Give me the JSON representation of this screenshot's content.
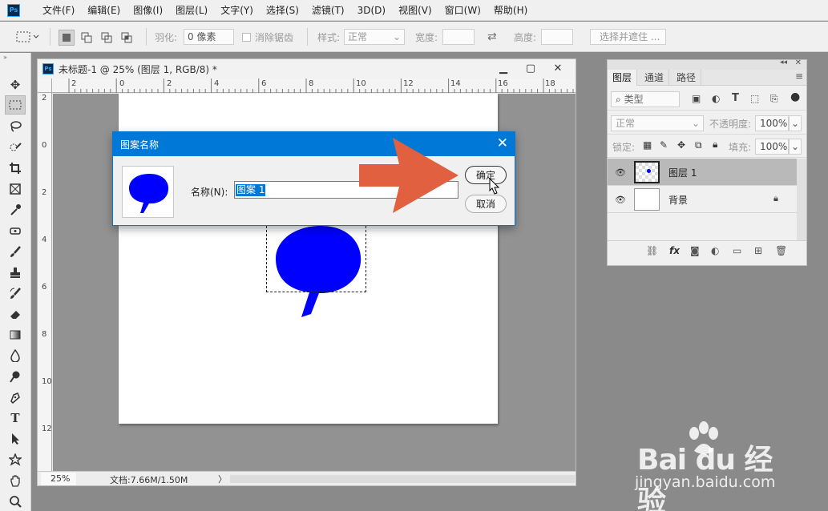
{
  "app": {
    "logo": "Ps",
    "menu": [
      "文件(F)",
      "编辑(E)",
      "图像(I)",
      "图层(L)",
      "文字(Y)",
      "选择(S)",
      "滤镜(T)",
      "3D(D)",
      "视图(V)",
      "窗口(W)",
      "帮助(H)"
    ]
  },
  "options": {
    "feather_label": "羽化:",
    "feather_value": "0 像素",
    "antialias_label": "消除锯齿",
    "style_label": "样式:",
    "style_value": "正常",
    "width_label": "宽度:",
    "height_label": "高度:",
    "select_mask_label": "选择并遮住 ..."
  },
  "tools": [
    "move-tool-icon",
    "marquee-tool-icon",
    "lasso-tool-icon",
    "quick-select-tool-icon",
    "crop-tool-icon",
    "frame-tool-icon",
    "eyedropper-tool-icon",
    "healing-tool-icon",
    "brush-tool-icon",
    "clone-stamp-tool-icon",
    "history-brush-tool-icon",
    "eraser-tool-icon",
    "gradient-tool-icon",
    "blur-tool-icon",
    "dodge-tool-icon",
    "pen-tool-icon",
    "type-tool-icon",
    "path-select-tool-icon",
    "shape-tool-icon",
    "hand-tool-icon",
    "zoom-tool-icon"
  ],
  "document": {
    "title": "未标题-1 @ 25% (图层 1, RGB/8) *",
    "ruler_h": [
      "2",
      "0",
      "2",
      "4",
      "6",
      "8",
      "10",
      "12",
      "14",
      "16",
      "18"
    ],
    "ruler_v": [
      "2",
      "0",
      "2",
      "4",
      "6",
      "8",
      "10",
      "12"
    ],
    "zoom": "25%",
    "info": "文档:7.66M/1.50M",
    "arrow": "〉"
  },
  "dialog": {
    "title": "图案名称",
    "name_label": "名称(N):",
    "name_value": "图案 1",
    "ok_label": "确定",
    "cancel_label": "取消"
  },
  "layers_panel": {
    "tabs": [
      "图层",
      "通道",
      "路径"
    ],
    "filter_label": "类型",
    "blend_mode": "正常",
    "opacity_label": "不透明度:",
    "opacity_value": "100%",
    "lock_label": "锁定:",
    "fill_label": "填充:",
    "fill_value": "100%",
    "layers": [
      {
        "name": "图层 1",
        "selected": true
      },
      {
        "name": "背景",
        "selected": false
      }
    ]
  },
  "colors": {
    "accent": "#0078d7",
    "shape_blue": "#0000ff",
    "arrow": "#e0603f"
  },
  "watermark": {
    "brand": "Bai du 经验",
    "url": "jingyan.baidu.com"
  }
}
